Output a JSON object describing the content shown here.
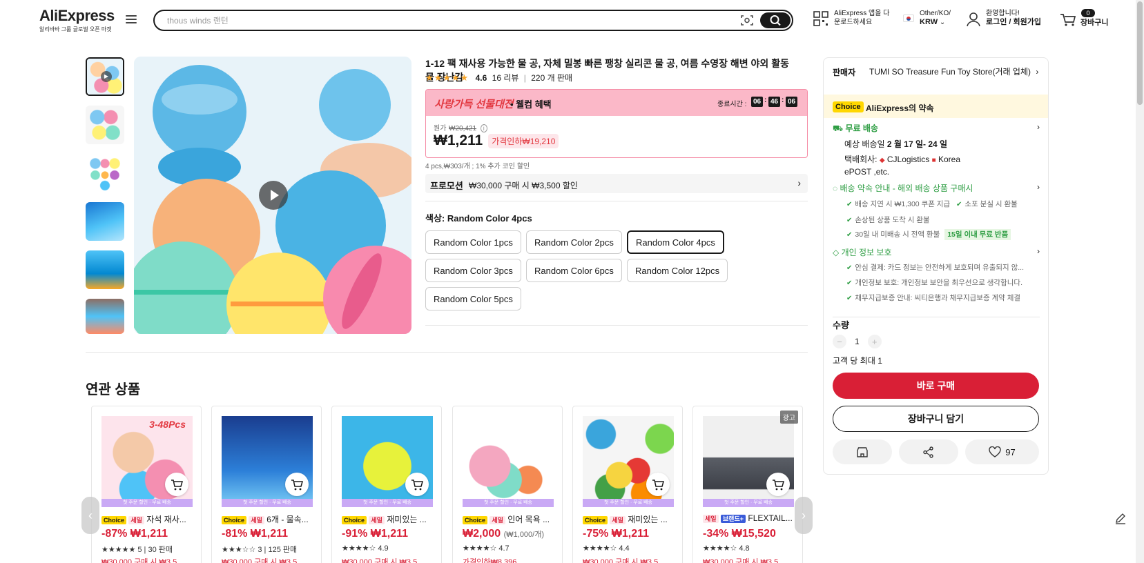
{
  "header": {
    "logo": "AliExpress",
    "logo_tagline": "알리바바 그룹 글로벌 오픈 마켓",
    "search_placeholder": "thous winds 랜턴",
    "app_line1": "AliExpress 앱을 다",
    "app_line2": "운로드하세요",
    "locale_line1": "Other/KO/",
    "locale_currency": "KRW",
    "account_line1": "환영합니다!",
    "account_line2": "로그인 / 회원가입",
    "cart_count": "0",
    "cart_label": "장바구니"
  },
  "product": {
    "title": "1-12 팩 재사용 가능한 물 공, 자체 밀봉 빠른 팽창 실리콘 물 공, 여름 수영장 해변 야외 활동 물 장난감",
    "rating": "4.6",
    "reviews": "16 리뷰",
    "sold": "220 개 판매",
    "promo_banner": "사랑가득 선물대전",
    "promo_banner_sub": "• 웰컴 혜택",
    "ends_label": "종료시간 :",
    "timer_h": "06",
    "timer_m": "46",
    "timer_s": "06",
    "original_label": "원가",
    "original_price": "₩20,421",
    "price": "₩1,211",
    "discount_pill": "가격인하₩19,210",
    "unit_note": "4 pcs,₩303/개 ; 1% 추가 코인 할인",
    "promotion_label": "프로모션",
    "promotion_text": "₩30,000 구매 시 ₩3,500 할인",
    "color_label": "색상:",
    "color_value": "Random Color 4pcs",
    "options": [
      "Random Color 1pcs",
      "Random Color 2pcs",
      "Random Color 4pcs",
      "Random Color 3pcs",
      "Random Color 6pcs",
      "Random Color 12pcs",
      "Random Color 5pcs"
    ]
  },
  "seller_card": {
    "seller_label": "판매자",
    "seller_name": "TUMI SO Treasure Fun Toy Store(거래 업체)",
    "choice_label": "Choice",
    "promise_title": "AliExpress의 약속",
    "free_shipping": "무료 배송",
    "delivery_prefix": "예상 배송일",
    "delivery_dates": "2 월 17 일- 24 일",
    "carrier_label": "택배회사:",
    "carrier_1": "CJLogistics",
    "carrier_2": "Korea",
    "carrier_3": "ePOST ,etc.",
    "delivery_promise": "배송 약속 안내 - 해외 배송 상품 구매시",
    "dp_items": [
      "배송 지연 시 ₩1,300 쿠폰 지급",
      "소포 분실 시 환불",
      "손상된 상품 도착 시 환불",
      "30일 내 미배송 시 전액 환불"
    ],
    "return_badge": "15일 이내 무료 반품",
    "privacy_title": "개인 정보 보호",
    "privacy_items": [
      "안심 결제: 카드 정보는 안전하게 보호되며 유출되지 않...",
      "개인정보 보호: 개인정보 보안을 최우선으로 생각합니다.",
      "채무지급보증 안내: 씨티은행과 채무지급보증 계약 체결"
    ],
    "qty_label": "수량",
    "qty_value": "1",
    "qty_minus": "−",
    "qty_plus": "+",
    "max_note": "고객 당 최대 1",
    "buy_now": "바로 구매",
    "add_cart": "장바구니 담기",
    "wishlist_count": "97"
  },
  "related": {
    "title": "연관 상품",
    "strip_text": "첫 주문 할인 · 무료 배송",
    "ad_label": "광고",
    "items": [
      {
        "tag": "Choice",
        "sale": "세일",
        "name": "자석 재사...",
        "price": "-87% ₩1,211",
        "stars": "★★★★★",
        "meta": "5 | 30 판매",
        "promo": "₩30,000 구매 시 ₩3,5"
      },
      {
        "tag": "Choice",
        "sale": "세일",
        "name": "6개 - 물속...",
        "price": "-81% ₩1,211",
        "stars": "★★★☆☆",
        "meta": "3 | 125 판매",
        "promo": "₩30,000 구매 시 ₩3,5"
      },
      {
        "tag": "Choice",
        "sale": "세일",
        "name": "재미있는 ...",
        "price": "-91% ₩1,211",
        "stars": "★★★★☆",
        "meta": "4.9",
        "promo": "₩30,000 구매 시 ₩3,5"
      },
      {
        "tag": "Choice",
        "sale": "세일",
        "name": "인어 목욕 ...",
        "price": "₩2,000",
        "price_unit": "(₩1,000/개)",
        "stars": "★★★★☆",
        "meta": "4.7",
        "promo": "가격인하₩8,396"
      },
      {
        "tag": "Choice",
        "sale": "세일",
        "name": "재미있는 ...",
        "price": "-75% ₩1,211",
        "stars": "★★★★☆",
        "meta": "4.4",
        "promo": "₩30,000 구매 시 ₩3,5"
      },
      {
        "tag": "",
        "sale": "세일",
        "brand": "브랜드+",
        "name": "FLEXTAIL...",
        "price": "-34% ₩15,520",
        "stars": "★★★★☆",
        "meta": "4.8",
        "promo": "₩30,000 구매 시 ₩3,5"
      }
    ]
  },
  "colors": {
    "accent_red": "#d91f36",
    "choice_yellow": "#ffd700",
    "promo_pink": "#fbb8c8",
    "green": "#2f9e44"
  }
}
